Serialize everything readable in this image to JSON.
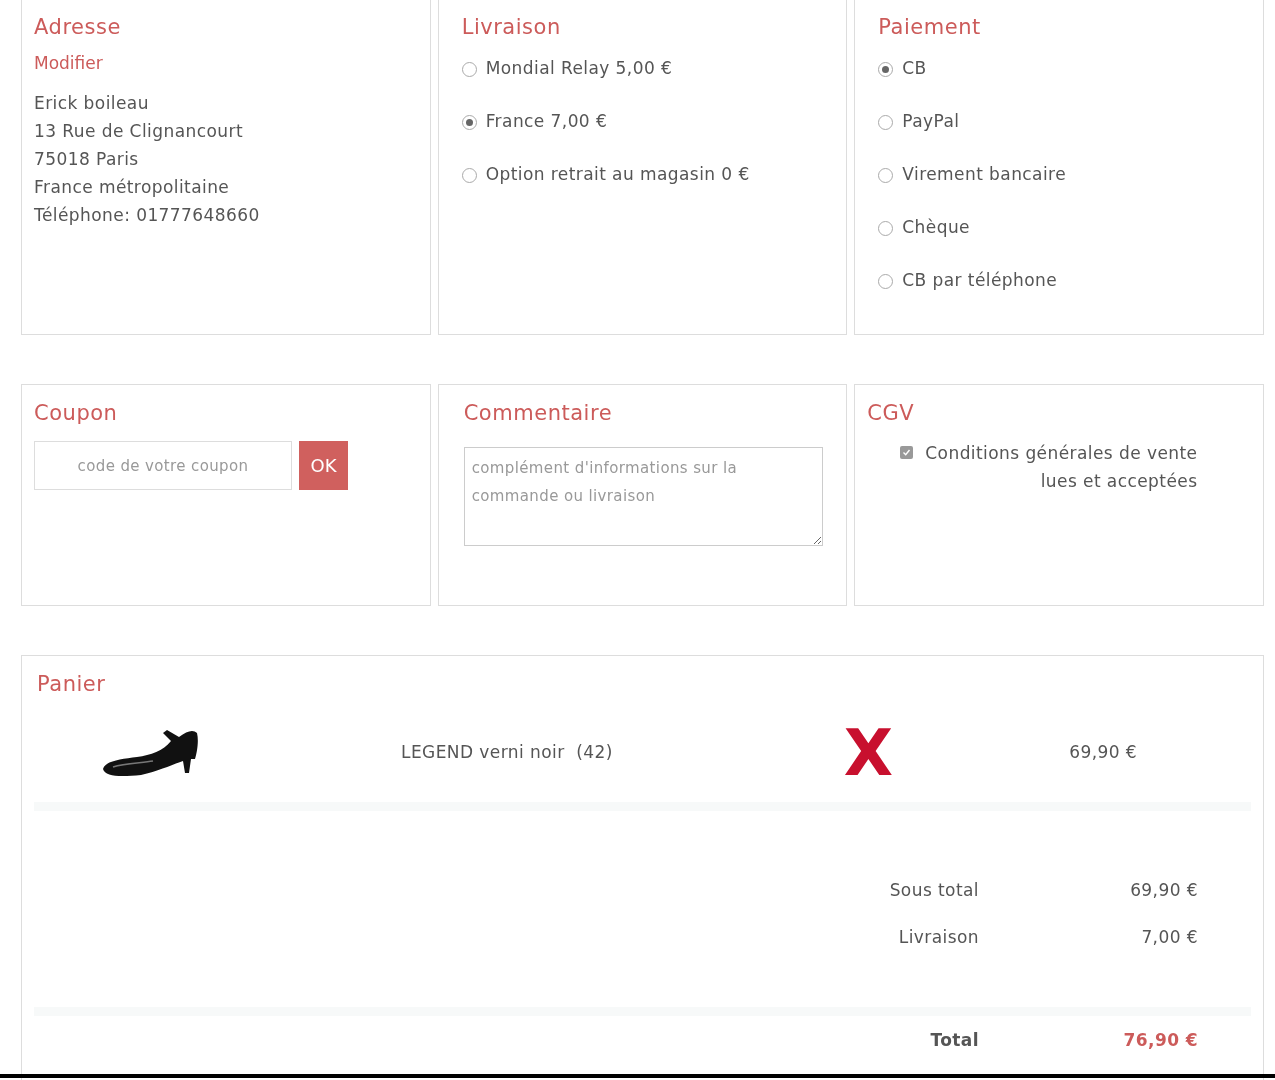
{
  "address": {
    "title": "Adresse",
    "edit_link": "Modifier",
    "lines": [
      "Erick boileau",
      "13 Rue de Clignancourt",
      "75018 Paris",
      "France métropolitaine",
      "Téléphone: 01777648660"
    ]
  },
  "delivery": {
    "title": "Livraison",
    "options": [
      {
        "label": "Mondial Relay 5,00 €",
        "selected": false
      },
      {
        "label": "France 7,00 €",
        "selected": true
      },
      {
        "label": "Option retrait au magasin 0 €",
        "selected": false
      }
    ]
  },
  "payment": {
    "title": "Paiement",
    "options": [
      {
        "label": "CB",
        "selected": true
      },
      {
        "label": "PayPal",
        "selected": false
      },
      {
        "label": "Virement bancaire",
        "selected": false
      },
      {
        "label": "Chèque",
        "selected": false
      },
      {
        "label": "CB par téléphone",
        "selected": false
      }
    ]
  },
  "coupon": {
    "title": "Coupon",
    "placeholder": "code de votre coupon",
    "button": "OK"
  },
  "comment": {
    "title": "Commentaire",
    "placeholder": "complément d'informations sur la commande ou livraison"
  },
  "terms": {
    "title": "CGV",
    "checked": true,
    "label_line_1": "Conditions générales de vente",
    "label_line_2": "lues et acceptées"
  },
  "cart": {
    "title": "Panier",
    "items": [
      {
        "name": "LEGEND verni noir  (42)",
        "price": "69,90 €",
        "remove": "X"
      }
    ],
    "subtotals": [
      {
        "label": "Sous total",
        "value": "69,90 €"
      },
      {
        "label": "Livraison",
        "value": "7,00 €"
      }
    ],
    "total": {
      "label": "Total",
      "value": "76,90 €"
    }
  }
}
